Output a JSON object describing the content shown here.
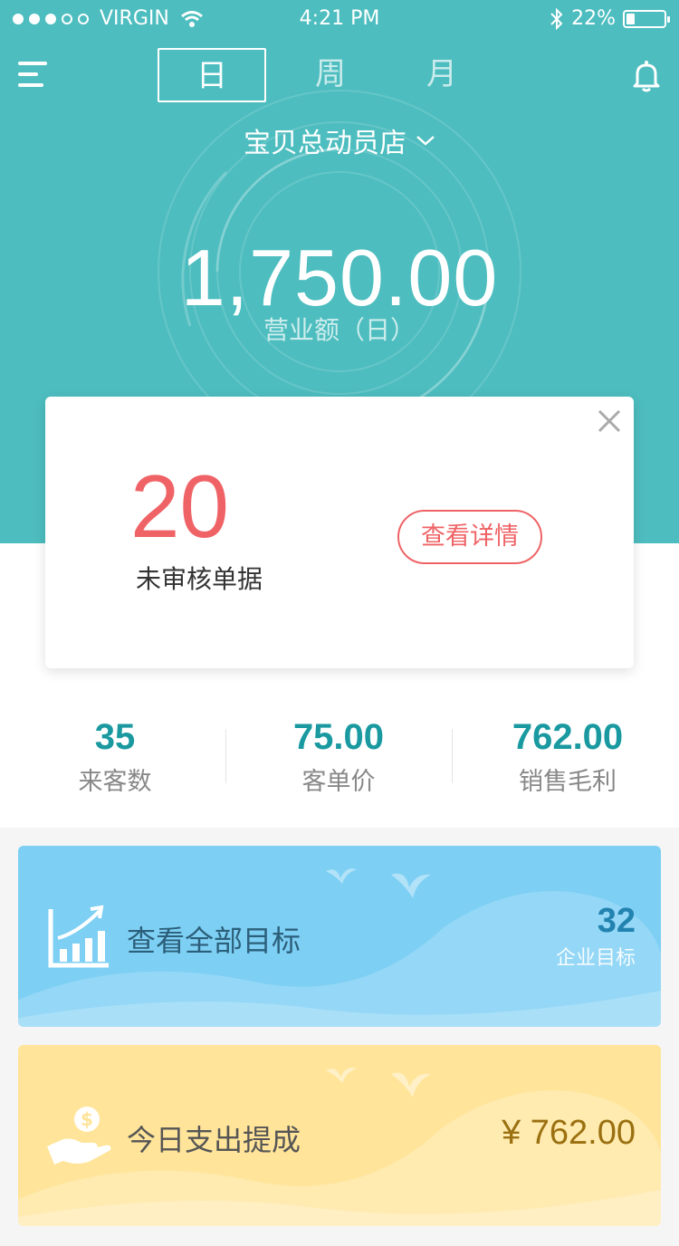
{
  "status_bar": {
    "carrier": "VIRGIN",
    "time": "4:21 PM",
    "battery": "22%",
    "battery_level": 0.22
  },
  "header": {
    "tabs": [
      {
        "label": "日",
        "active": true
      },
      {
        "label": "周",
        "active": false
      },
      {
        "label": "月",
        "active": false
      }
    ],
    "store_name": "宝贝总动员店"
  },
  "hero": {
    "revenue": "1,750.00",
    "revenue_label": "营业额（日）"
  },
  "alert_card": {
    "count": "20",
    "count_label": "未审核单据",
    "detail_button": "查看详情"
  },
  "stats": [
    {
      "value": "35",
      "label": "来客数"
    },
    {
      "value": "75.00",
      "label": "客单价"
    },
    {
      "value": "762.00",
      "label": "销售毛利"
    }
  ],
  "goals_banner": {
    "title": "查看全部目标",
    "count": "32",
    "count_label": "企业目标"
  },
  "payout_banner": {
    "title": "今日支出提成",
    "amount": "¥ 762.00"
  },
  "colors": {
    "primary": "#4dbdbf",
    "alert": "#ef6366",
    "stat_value": "#1a9aa0",
    "goal_bg": "#7dcff4",
    "payout_bg": "#ffe499"
  },
  "icons": [
    "menu-icon",
    "bell-icon",
    "chevron-down-icon",
    "close-icon",
    "growth-chart-icon",
    "money-hand-icon",
    "wifi-icon",
    "bluetooth-icon"
  ]
}
